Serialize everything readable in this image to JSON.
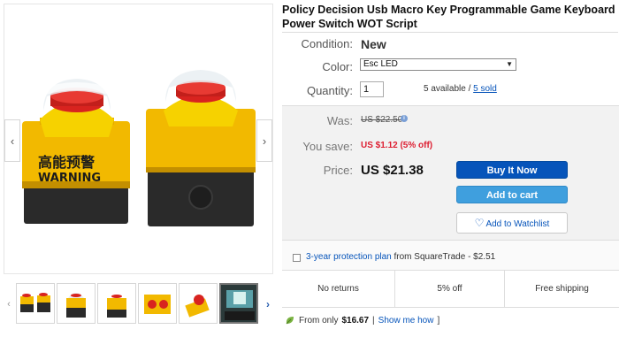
{
  "gallery": {
    "prev_icon": "chevron-left-icon",
    "next_icon": "chevron-right-icon",
    "label_left": "高能预警",
    "label_left_sub": "WARNING",
    "prev_glyph": "‹",
    "next_glyph": "›",
    "thumb_prev_glyph": "‹",
    "thumb_next_glyph": "›"
  },
  "thumbnails": [
    {
      "name": "thumb-1",
      "active": false
    },
    {
      "name": "thumb-2",
      "active": false
    },
    {
      "name": "thumb-3",
      "active": false
    },
    {
      "name": "thumb-4",
      "active": false
    },
    {
      "name": "thumb-5",
      "active": false
    },
    {
      "name": "thumb-6",
      "active": true
    }
  ],
  "product": {
    "title": "Policy Decision Usb Macro Key Programmable Game Keyboard Power Switch WOT Script"
  },
  "details": {
    "condition_label": "Condition:",
    "condition_value": "New",
    "color_label": "Color:",
    "color_value": "Esc LED",
    "quantity_label": "Quantity:",
    "quantity_value": "1",
    "available_text": "5 available / ",
    "sold_text": "5 sold"
  },
  "pricing": {
    "was_label": "Was:",
    "was_value": "US $22.50",
    "save_label": "You save:",
    "save_value": "US $1.12 (5% off)",
    "price_label": "Price:",
    "price_value": "US $21.38"
  },
  "buttons": {
    "buy_now": "Buy It Now",
    "add_to_cart": "Add to cart",
    "watchlist": "Add to Watchlist"
  },
  "protection": {
    "plan_link": "3-year protection plan",
    "plan_rest": " from SquareTrade - $2.51"
  },
  "features": {
    "returns": "No returns",
    "discount": "5% off",
    "shipping": "Free shipping"
  },
  "financing": {
    "prefix": "From only ",
    "amount": "$16.67",
    "separator": " | ",
    "link": "Show me how",
    "suffix": " ]"
  },
  "colors": {
    "accent_blue": "#0654ba",
    "cart_blue": "#3f9fde",
    "save_red": "#dd1e31",
    "switch_yellow": "#f5c400",
    "button_red": "#d8231f"
  }
}
